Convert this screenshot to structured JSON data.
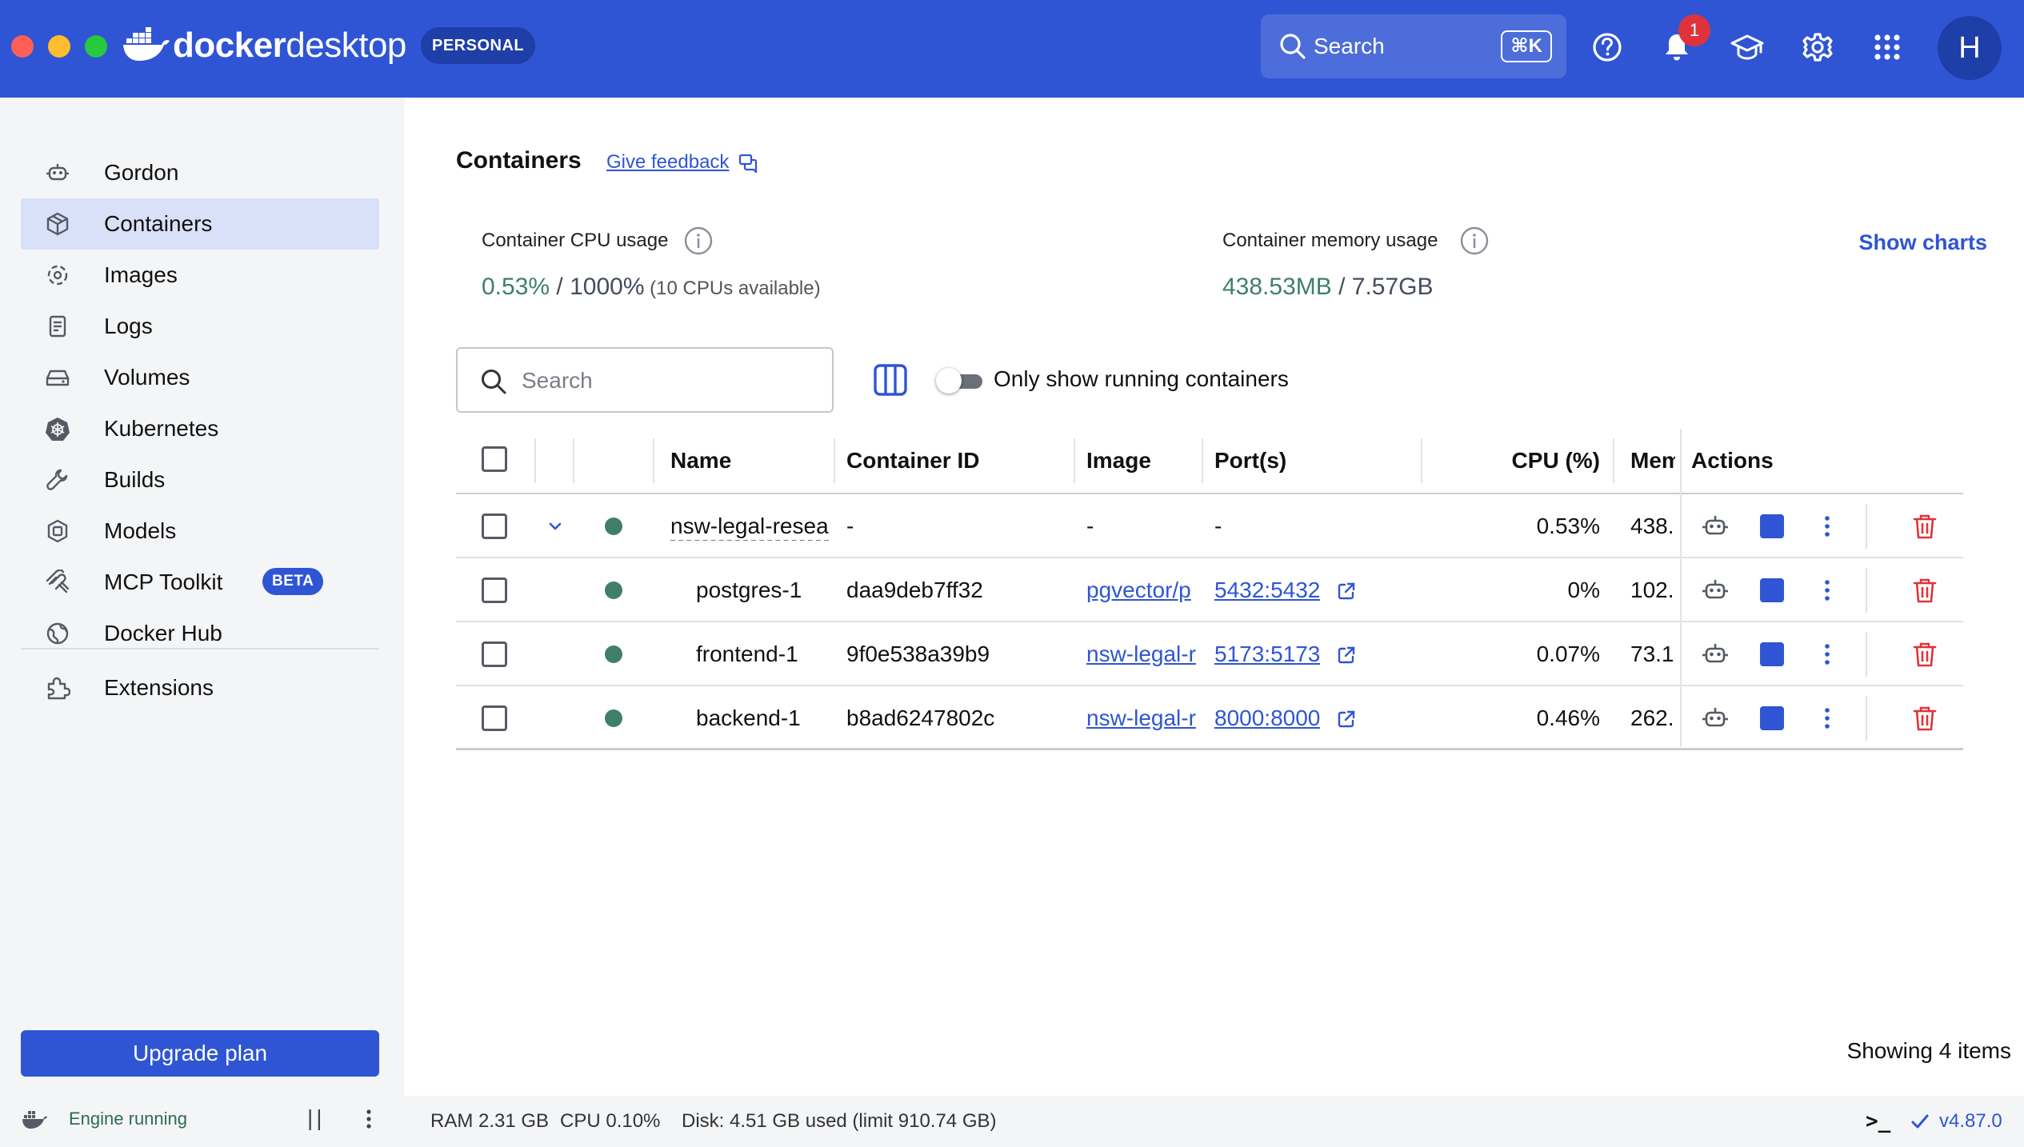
{
  "app": {
    "brand_bold": "docker",
    "brand_light": "desktop",
    "plan_badge": "PERSONAL",
    "search_label": "Search",
    "search_shortcut": "⌘K",
    "notification_count": "1",
    "avatar_initial": "H"
  },
  "sidebar": {
    "items": [
      {
        "label": "Gordon",
        "icon": "gordon-robot-icon"
      },
      {
        "label": "Containers",
        "icon": "containers-cube-icon",
        "active": true
      },
      {
        "label": "Images",
        "icon": "images-icon"
      },
      {
        "label": "Logs",
        "icon": "logs-document-icon"
      },
      {
        "label": "Volumes",
        "icon": "volumes-drive-icon"
      },
      {
        "label": "Kubernetes",
        "icon": "kubernetes-helm-icon"
      },
      {
        "label": "Builds",
        "icon": "builds-wrench-icon"
      },
      {
        "label": "Models",
        "icon": "models-icon"
      },
      {
        "label": "MCP Toolkit",
        "icon": "mcp-toolkit-icon",
        "badge": "BETA"
      },
      {
        "label": "Docker Hub",
        "icon": "docker-hub-globe-icon"
      },
      {
        "label": "Extensions",
        "icon": "extensions-puzzle-icon"
      }
    ],
    "upgrade_label": "Upgrade plan",
    "engine_status": "Engine running"
  },
  "main": {
    "title": "Containers",
    "feedback_label": "Give feedback",
    "cpu_label": "Container CPU usage",
    "cpu_used": "0.53%",
    "cpu_separator": " / ",
    "cpu_total": "1000%",
    "cpu_note": " (10 CPUs available)",
    "mem_label": "Container memory usage",
    "mem_used": "438.53MB",
    "mem_separator": " / ",
    "mem_total": "7.57GB",
    "show_charts": "Show charts",
    "search_placeholder": "Search",
    "toggle_label": "Only show running containers",
    "toggle_on": false,
    "columns": [
      "Name",
      "Container ID",
      "Image",
      "Port(s)",
      "CPU (%)",
      "Mem",
      "Actions"
    ],
    "rows": [
      {
        "name": "nsw-legal-resea",
        "id": "-",
        "image": "-",
        "port": "-",
        "cpu": "0.53%",
        "mem": "438.",
        "group": true
      },
      {
        "name": "postgres-1",
        "id": "daa9deb7ff32",
        "image": "pgvector/p",
        "port": "5432:5432",
        "cpu": "0%",
        "mem": "102."
      },
      {
        "name": "frontend-1",
        "id": "9f0e538a39b9",
        "image": "nsw-legal-r",
        "port": "5173:5173",
        "cpu": "0.07%",
        "mem": "73.1"
      },
      {
        "name": "backend-1",
        "id": "b8ad6247802c",
        "image": "nsw-legal-r",
        "port": "8000:8000",
        "cpu": "0.46%",
        "mem": "262."
      }
    ],
    "showing": "Showing 4 items"
  },
  "footer": {
    "ram": "RAM 2.31 GB",
    "cpu": "CPU 0.10%",
    "disk": "Disk: 4.51 GB used (limit 910.74 GB)",
    "terminal": ">_",
    "version": "v4.87.0"
  },
  "colors": {
    "brand_blue": "#2f55d4",
    "running_green": "#3f7f69",
    "delete_red": "#e0323c"
  }
}
